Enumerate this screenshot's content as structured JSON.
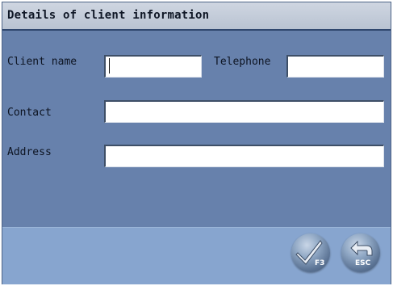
{
  "dialog": {
    "title": "Details of client information"
  },
  "form": {
    "client_name_label": "Client name",
    "client_name_value": "",
    "telephone_label": "Telephone",
    "telephone_value": "",
    "contact_label": "Contact",
    "contact_value": "",
    "address_label": "Address",
    "address_value": ""
  },
  "buttons": {
    "confirm_key": "F3",
    "escape_key": "ESC",
    "confirm_icon": "checkmark-icon",
    "escape_icon": "return-arrow-icon"
  }
}
